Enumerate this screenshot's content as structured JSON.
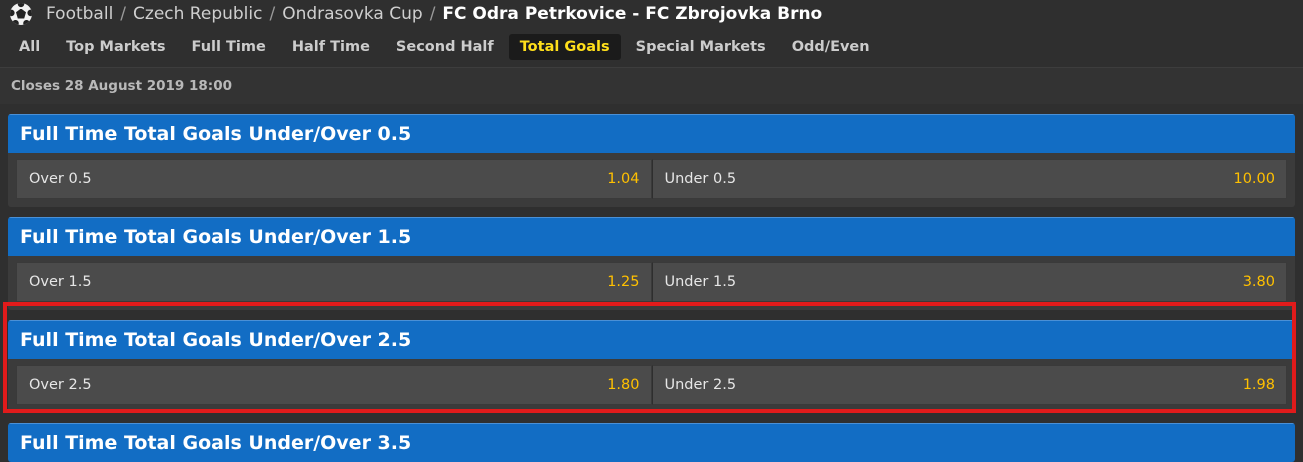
{
  "breadcrumb": {
    "items": [
      "Football",
      "Czech Republic",
      "Ondrasovka Cup"
    ],
    "separator": "/",
    "current": "FC Odra Petrkovice - FC Zbrojovka Brno"
  },
  "tabs": [
    {
      "label": "All",
      "active": false
    },
    {
      "label": "Top Markets",
      "active": false
    },
    {
      "label": "Full Time",
      "active": false
    },
    {
      "label": "Half Time",
      "active": false
    },
    {
      "label": "Second Half",
      "active": false
    },
    {
      "label": "Total Goals",
      "active": true
    },
    {
      "label": "Special Markets",
      "active": false
    },
    {
      "label": "Odd/Even",
      "active": false
    }
  ],
  "closes": "Closes 28 August 2019 18:00",
  "markets": [
    {
      "title": "Full Time Total Goals Under/Over 0.5",
      "selections": [
        {
          "label": "Over 0.5",
          "odds": "1.04"
        },
        {
          "label": "Under 0.5",
          "odds": "10.00"
        }
      ]
    },
    {
      "title": "Full Time Total Goals Under/Over 1.5",
      "selections": [
        {
          "label": "Over 1.5",
          "odds": "1.25"
        },
        {
          "label": "Under 1.5",
          "odds": "3.80"
        }
      ]
    },
    {
      "title": "Full Time Total Goals Under/Over 2.5",
      "highlighted": true,
      "selections": [
        {
          "label": "Over 2.5",
          "odds": "1.80"
        },
        {
          "label": "Under 2.5",
          "odds": "1.98"
        }
      ]
    },
    {
      "title": "Full Time Total Goals Under/Over 3.5",
      "selections": []
    }
  ],
  "colors": {
    "background": "#2f2f2f",
    "market_header": "#126dc4",
    "active_tab_text": "#ffdf1b",
    "odds": "#ffc000",
    "highlight_border": "#e11b1b"
  },
  "icons": {
    "sport": "soccer-ball-icon"
  }
}
